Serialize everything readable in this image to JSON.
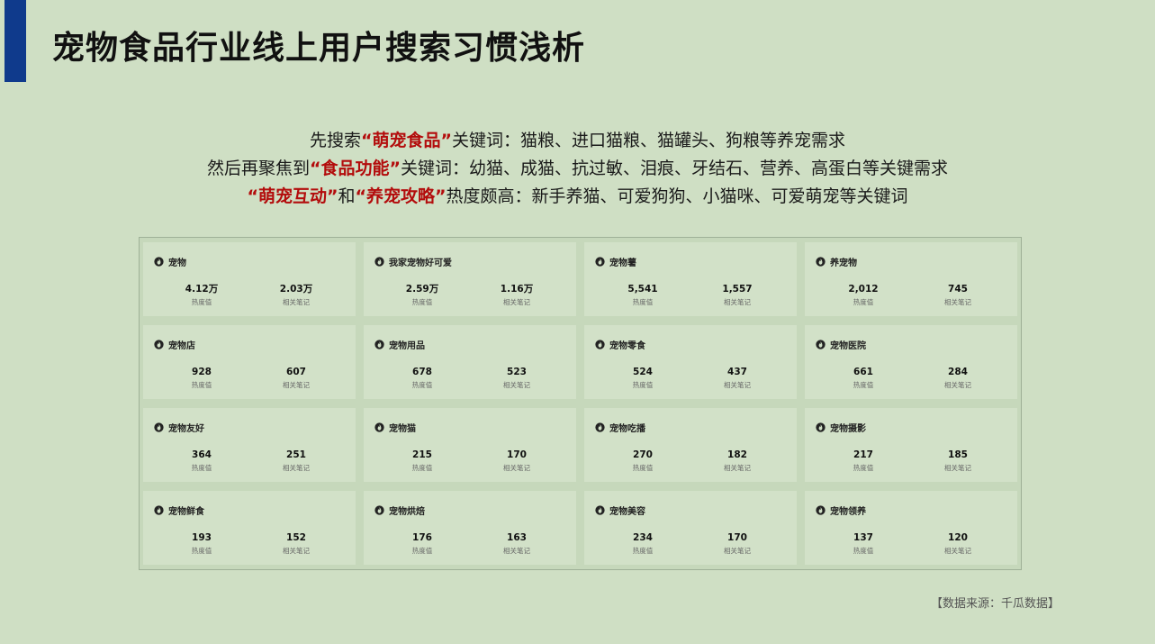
{
  "page": {
    "title": "宠物食品行业线上用户搜索习惯浅析",
    "source": "【数据来源：千瓜数据】"
  },
  "colors": {
    "accent_bar": "#0f3a8c",
    "highlight": "#b30c0c",
    "background": "#cfdfc4"
  },
  "intro": {
    "line1": {
      "pre": "先搜索",
      "hl": "“萌宠食品”",
      "post": "关键词：猫粮、进口猫粮、猫罐头、狗粮等养宠需求"
    },
    "line2": {
      "pre": "然后再聚焦到",
      "hl": "“食品功能”",
      "post": "关键词：幼猫、成猫、抗过敏、泪痕、牙结石、营养、高蛋白等关键需求"
    },
    "line3": {
      "hl1": "“萌宠互动”",
      "mid": "和",
      "hl2": "“养宠攻略”",
      "post": "热度颇高：新手养猫、可爱狗狗、小猫咪、可爱萌宠等关键词"
    }
  },
  "cards_meta": {
    "heat_label": "热度值",
    "notes_label": "相关笔记",
    "icon": "flame-icon"
  },
  "cards": [
    {
      "keyword": "宠物",
      "heat": "4.12万",
      "notes": "2.03万"
    },
    {
      "keyword": "我家宠物好可爱",
      "heat": "2.59万",
      "notes": "1.16万"
    },
    {
      "keyword": "宠物薯",
      "heat": "5,541",
      "notes": "1,557"
    },
    {
      "keyword": "养宠物",
      "heat": "2,012",
      "notes": "745"
    },
    {
      "keyword": "宠物店",
      "heat": "928",
      "notes": "607"
    },
    {
      "keyword": "宠物用品",
      "heat": "678",
      "notes": "523"
    },
    {
      "keyword": "宠物零食",
      "heat": "524",
      "notes": "437"
    },
    {
      "keyword": "宠物医院",
      "heat": "661",
      "notes": "284"
    },
    {
      "keyword": "宠物友好",
      "heat": "364",
      "notes": "251"
    },
    {
      "keyword": "宠物猫",
      "heat": "215",
      "notes": "170"
    },
    {
      "keyword": "宠物吃播",
      "heat": "270",
      "notes": "182"
    },
    {
      "keyword": "宠物摄影",
      "heat": "217",
      "notes": "185"
    },
    {
      "keyword": "宠物鲜食",
      "heat": "193",
      "notes": "152"
    },
    {
      "keyword": "宠物烘焙",
      "heat": "176",
      "notes": "163"
    },
    {
      "keyword": "宠物美容",
      "heat": "234",
      "notes": "170"
    },
    {
      "keyword": "宠物领养",
      "heat": "137",
      "notes": "120"
    }
  ]
}
